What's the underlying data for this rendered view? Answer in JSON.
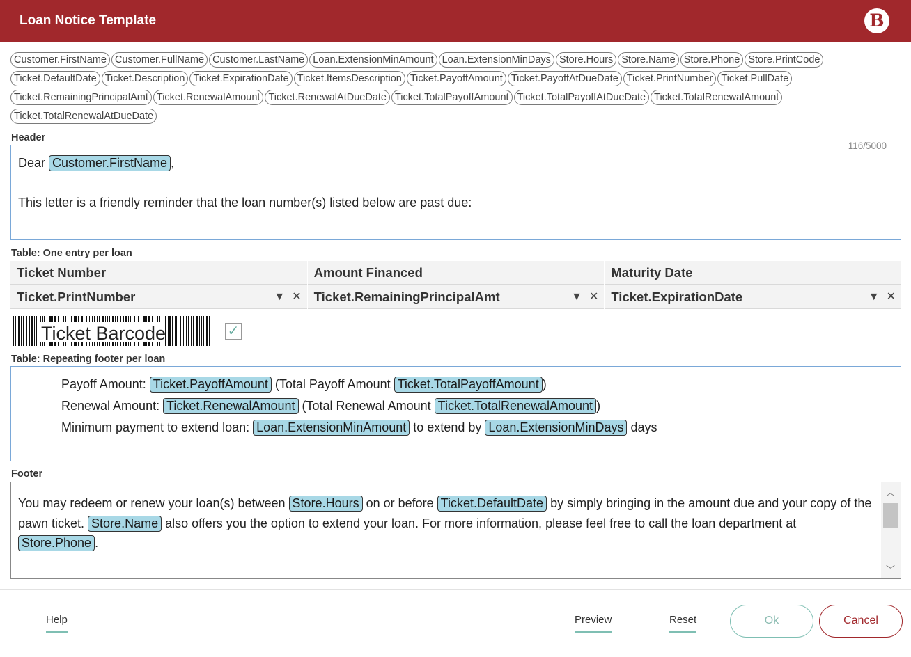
{
  "window": {
    "title": "Loan Notice Template",
    "logo_text": "B"
  },
  "tokens": [
    "Customer.FirstName",
    "Customer.FullName",
    "Customer.LastName",
    "Loan.ExtensionMinAmount",
    "Loan.ExtensionMinDays",
    "Store.Hours",
    "Store.Name",
    "Store.Phone",
    "Store.PrintCode",
    "Ticket.DefaultDate",
    "Ticket.Description",
    "Ticket.ExpirationDate",
    "Ticket.ItemsDescription",
    "Ticket.PayoffAmount",
    "Ticket.PayoffAtDueDate",
    "Ticket.PrintNumber",
    "Ticket.PullDate",
    "Ticket.RemainingPrincipalAmt",
    "Ticket.RenewalAmount",
    "Ticket.RenewalAtDueDate",
    "Ticket.TotalPayoffAmount",
    "Ticket.TotalPayoffAtDueDate",
    "Ticket.TotalRenewalAmount",
    "Ticket.TotalRenewalAtDueDate"
  ],
  "header": {
    "label": "Header",
    "counter": "116/5000",
    "greeting_prefix": "Dear ",
    "greeting_chip": "Customer.FirstName",
    "greeting_suffix": ",",
    "body_line": "This letter is a friendly reminder that the loan number(s) listed below are past due:"
  },
  "table": {
    "label": "Table: One entry per loan",
    "columns": [
      "Ticket Number",
      "Amount Financed",
      "Maturity Date"
    ],
    "fields": [
      "Ticket.PrintNumber",
      "Ticket.RemainingPrincipalAmt",
      "Ticket.ExpirationDate"
    ],
    "dropdown_glyph": "▼",
    "clear_glyph": "✕"
  },
  "barcode": {
    "label": "Ticket Barcode",
    "checked_glyph": "✓"
  },
  "repeating_footer": {
    "label": "Table: Repeating footer per loan",
    "line1": {
      "a": "Payoff Amount: ",
      "chip1": "Ticket.PayoffAmount",
      "b": " (Total Payoff Amount ",
      "chip2": "Ticket.TotalPayoffAmount",
      "c": ")"
    },
    "line2": {
      "a": "Renewal Amount: ",
      "chip1": "Ticket.RenewalAmount",
      "b": " (Total Renewal Amount ",
      "chip2": "Ticket.TotalRenewalAmount",
      "c": ")"
    },
    "line3": {
      "a": "Minimum payment to extend loan: ",
      "chip1": "Loan.ExtensionMinAmount",
      "b": " to extend by ",
      "chip2": "Loan.ExtensionMinDays",
      "c": " days"
    }
  },
  "footer": {
    "label": "Footer",
    "t1": "You may redeem or renew your loan(s) between ",
    "c1": "Store.Hours",
    "t2": " on or before ",
    "c2": "Ticket.DefaultDate",
    "t3": " by simply bringing in the amount due and your copy of the pawn ticket. ",
    "c3": "Store.Name",
    "t4": " also offers you the option to extend your loan. For more information, please feel free to call the loan department at ",
    "c4": "Store.Phone",
    "t5": "."
  },
  "buttons": {
    "help": "Help",
    "preview": "Preview",
    "reset": "Reset",
    "ok": "Ok",
    "cancel": "Cancel"
  }
}
